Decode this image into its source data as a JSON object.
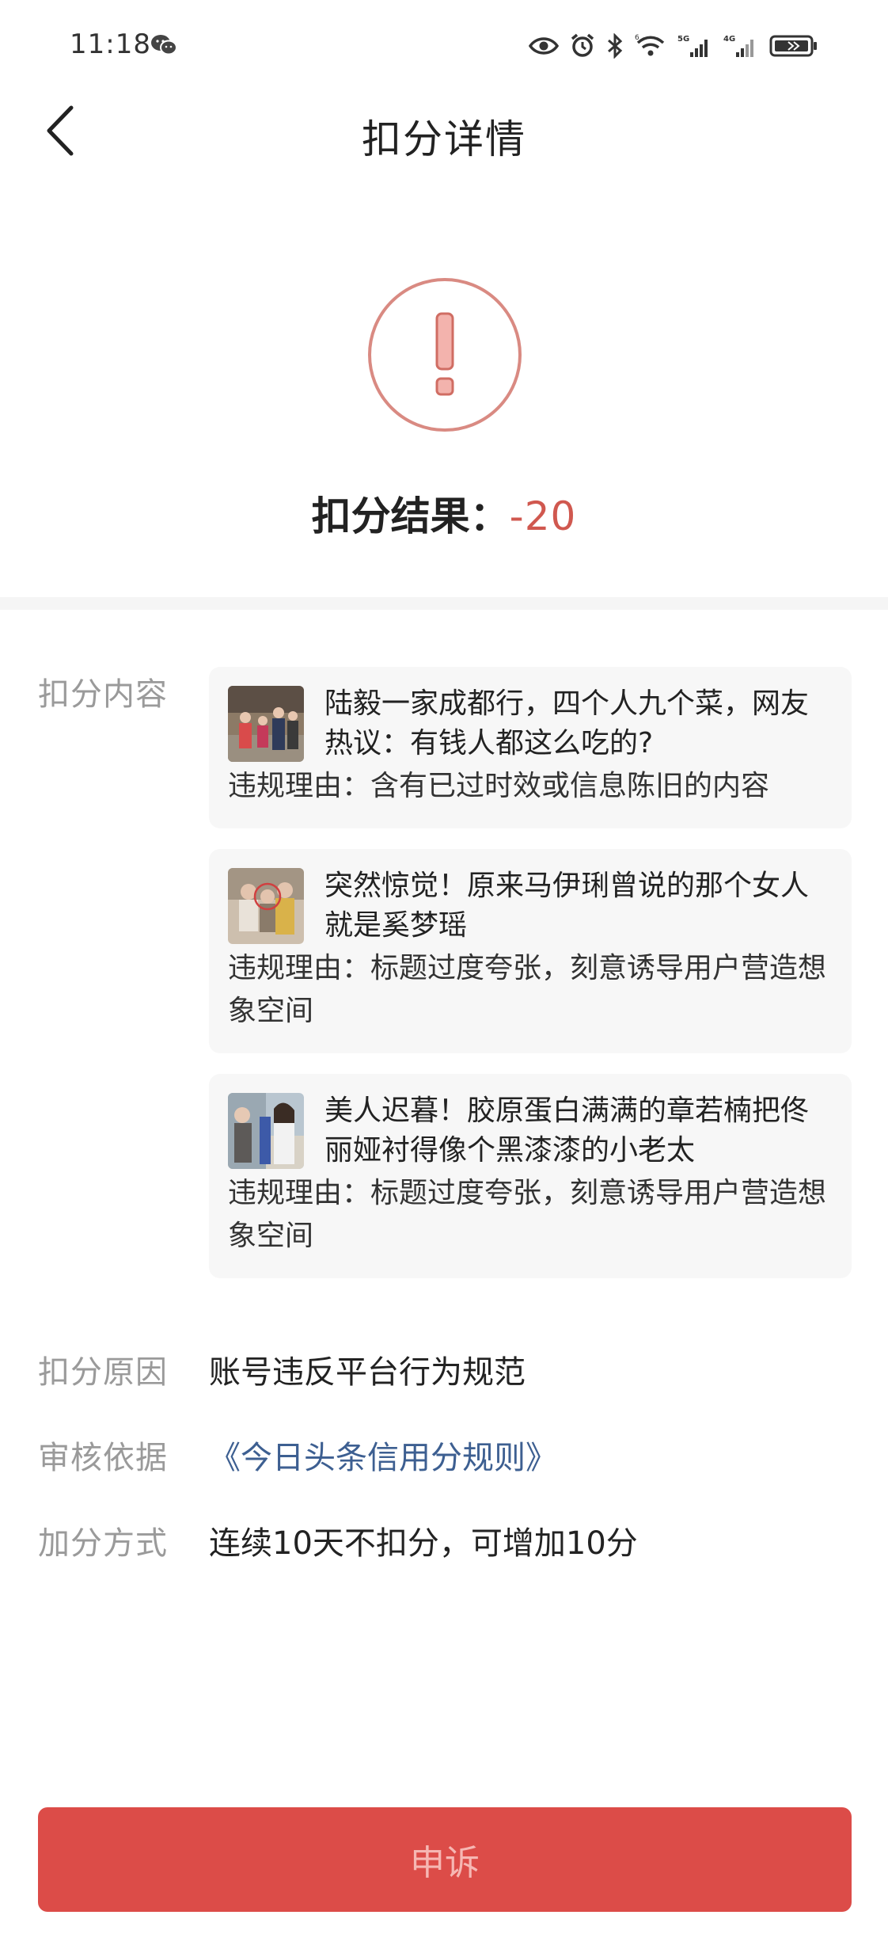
{
  "status_bar": {
    "time": "11:18",
    "icons": [
      "wechat-icon",
      "eye-icon",
      "alarm-icon",
      "bluetooth-icon",
      "wifi-icon",
      "signal-5g-icon",
      "signal-4g-icon",
      "battery-icon"
    ]
  },
  "header": {
    "title": "扣分详情"
  },
  "result": {
    "label": "扣分结果：",
    "value": "-20"
  },
  "content": {
    "label": "扣分内容",
    "items": [
      {
        "title": "陆毅一家成都行，四个人九个菜，网友热议：有钱人都这么吃的?",
        "reason": "违规理由：含有已过时效或信息陈旧的内容"
      },
      {
        "title": "突然惊觉！原来马伊琍曾说的那个女人就是奚梦瑶",
        "reason": "违规理由：标题过度夸张，刻意诱导用户营造想象空间"
      },
      {
        "title": "美人迟暮！胶原蛋白满满的章若楠把佟丽娅衬得像个黑漆漆的小老太",
        "reason": "违规理由：标题过度夸张，刻意诱导用户营造想象空间"
      }
    ]
  },
  "reason": {
    "label": "扣分原因",
    "value": "账号违反平台行为规范"
  },
  "basis": {
    "label": "审核依据",
    "value": "《今日头条信用分规则》"
  },
  "bonus": {
    "label": "加分方式",
    "value": "连续10天不扣分，可增加10分"
  },
  "footer": {
    "button_label": "申诉"
  },
  "colors": {
    "accent_red": "#dc4c48",
    "result_red": "#d0584f",
    "link_blue": "#3d5f91"
  }
}
